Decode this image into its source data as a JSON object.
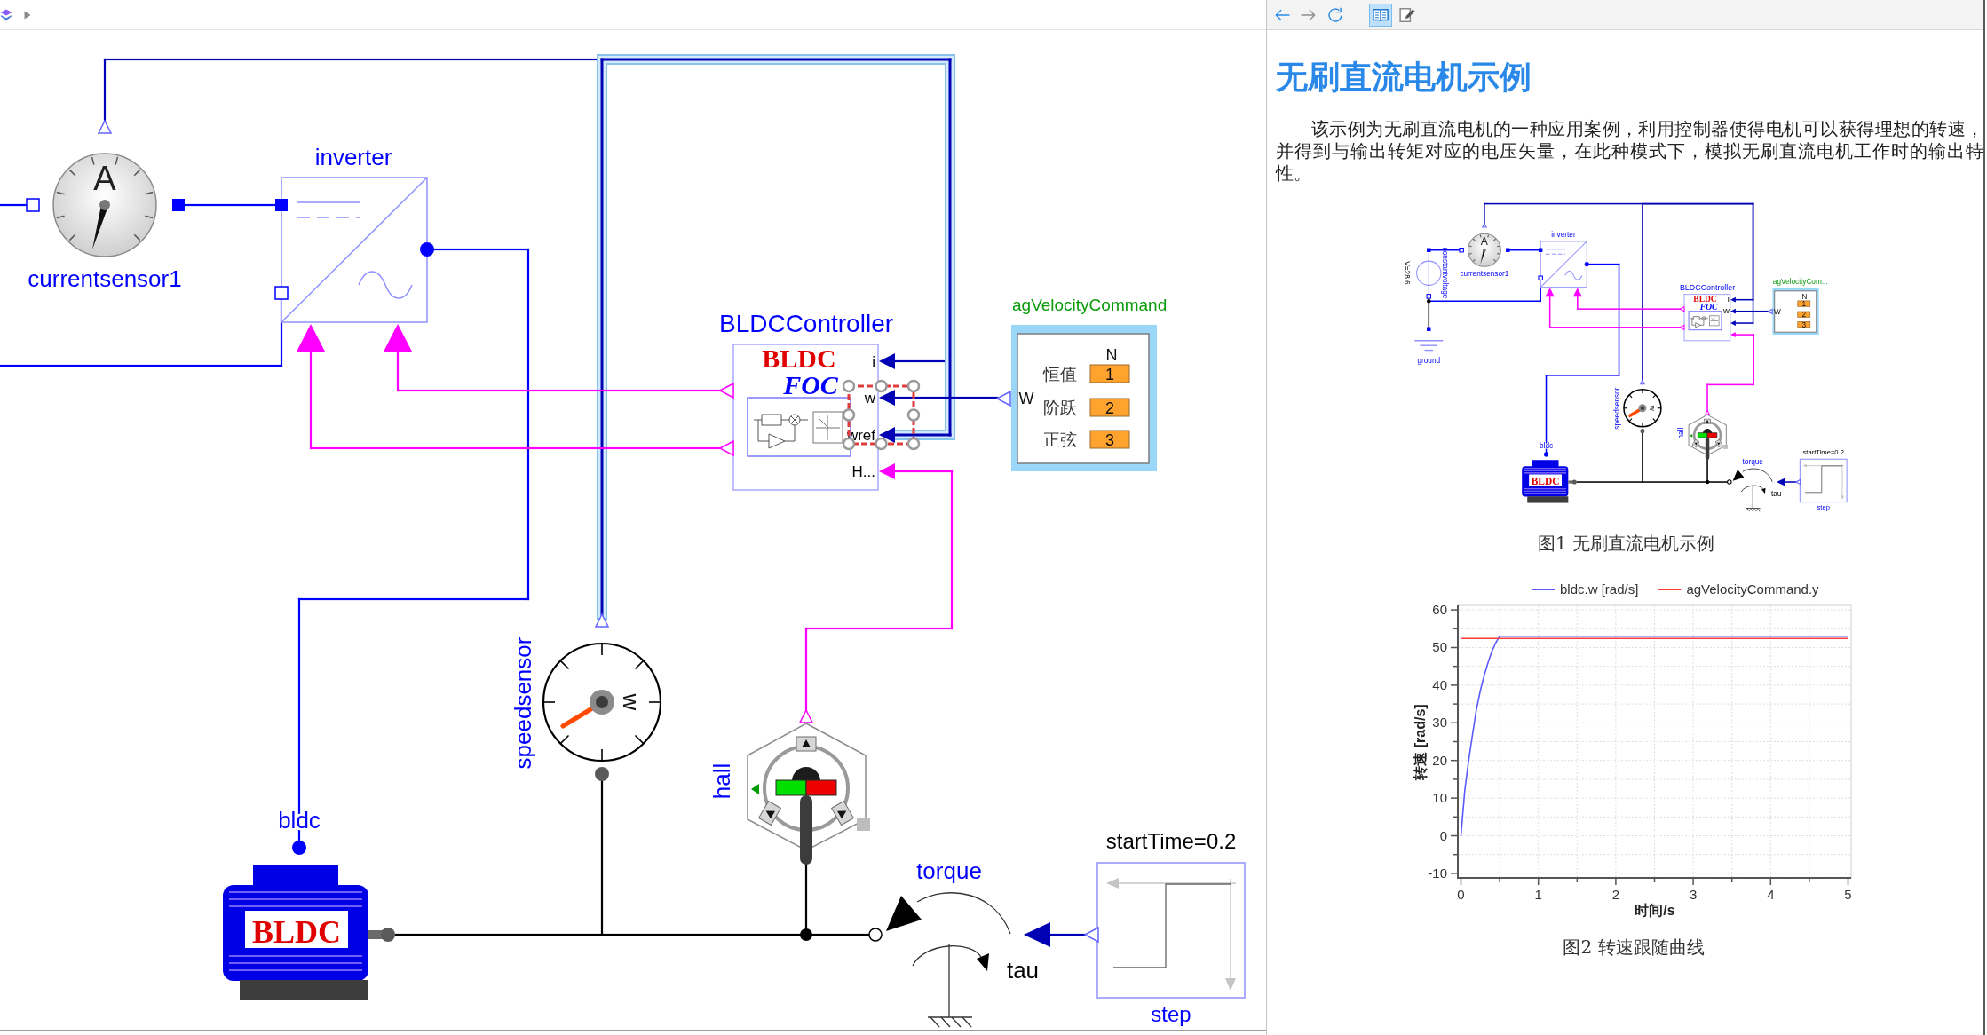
{
  "toolbar": {
    "nav_buttons": [
      {
        "disabled": false
      },
      {
        "disabled": true
      }
    ],
    "mode_buttons": [
      {
        "selected": true
      },
      {
        "selected": false
      }
    ]
  },
  "diagram": {
    "components": [
      {
        "kind": "current_sensor",
        "label": "currentsensor1",
        "symbol": "A"
      },
      {
        "kind": "inverter",
        "label": "inverter"
      },
      {
        "kind": "controller",
        "label": "BLDCController",
        "title": "BLDC",
        "subtitle": "FOC",
        "ports": [
          {
            "label": "i",
            "selected": false
          },
          {
            "label": "w",
            "selected": false
          },
          {
            "label": "wref",
            "selected": true
          },
          {
            "label": "H...",
            "selected": false
          }
        ]
      },
      {
        "kind": "command",
        "label": "agVelocityCommand",
        "port_label": "W",
        "column_header": "N",
        "rows": [
          {
            "label": "恒值",
            "value": "1"
          },
          {
            "label": "阶跃",
            "value": "2"
          },
          {
            "label": "正弦",
            "value": "3"
          }
        ]
      },
      {
        "kind": "speed_sensor",
        "label": "speedsensor",
        "symbol": "w"
      },
      {
        "kind": "hall_sensor",
        "label": "hall"
      },
      {
        "kind": "motor",
        "label": "bldc",
        "badge": "BLDC"
      },
      {
        "kind": "torque",
        "label": "torque",
        "input_label": "tau"
      },
      {
        "kind": "step",
        "parameter": "startTime=0.2",
        "label": "step"
      }
    ],
    "connections": [
      {
        "selected": false
      },
      {
        "selected": true
      },
      {
        "selected": false
      },
      {
        "selected": false
      },
      {
        "selected": false
      },
      {
        "selected": false
      },
      {
        "selected": false
      },
      {
        "selected": false
      },
      {
        "selected": false
      },
      {
        "selected": false
      },
      {
        "selected": false
      },
      {
        "selected": false
      },
      {
        "selected": false
      },
      {
        "selected": false
      }
    ]
  },
  "document": {
    "title": "无刷直流电机示例",
    "paragraph": "该示例为无刷直流电机的一种应用案例，利用控制器使得电机可以获得理想的转速，并得到与输出转矩对应的电压矢量，在此种模式下，模拟无刷直流电机工作时的输出特性。",
    "figure_1": {
      "components": [
        {
          "kind": "voltage_source",
          "label": "constantvoltage",
          "parameter": "V=28.6"
        },
        {
          "kind": "current_sensor",
          "label": "currentsensor1",
          "symbol": "A"
        },
        {
          "kind": "inverter",
          "label": "inverter"
        },
        {
          "kind": "ground",
          "label": "ground"
        },
        {
          "kind": "controller",
          "label": "BLDCController",
          "title": "BLDC",
          "subtitle": "FOC",
          "ports": [
            {
              "label": "i"
            },
            {
              "label": "w"
            }
          ]
        },
        {
          "kind": "command",
          "label": "agVelocityCom...",
          "port_label": "W",
          "column_header": "N",
          "rows": [
            {
              "value": "1"
            },
            {
              "value": "2"
            },
            {
              "value": "3"
            }
          ]
        },
        {
          "kind": "speed_sensor",
          "label": "speedsensor",
          "symbol": "w"
        },
        {
          "kind": "hall_sensor",
          "label": "hall"
        },
        {
          "kind": "motor",
          "label": "bldc",
          "badge": "BLDC"
        },
        {
          "kind": "torque",
          "label": "torque",
          "input_label": "tau"
        },
        {
          "kind": "step",
          "parameter": "startTime=0.2",
          "label": "step"
        }
      ],
      "caption": "图1 无刷直流电机示例"
    },
    "figure_2": {
      "chart_data": {
        "type": "line",
        "xlabel": "时间/s",
        "ylabel": "转速 [rad/s]",
        "x": [
          0,
          0.05,
          0.1,
          0.15,
          0.2,
          0.25,
          0.3,
          0.35,
          0.4,
          0.45,
          0.5,
          1,
          2,
          3,
          4,
          5
        ],
        "series": [
          {
            "name": "bldc.w [rad/s]",
            "color": "#5a5aff",
            "values": [
              0,
              12,
              20,
              27,
              33.5,
              38.5,
              42.5,
              46,
              49,
              51.3,
              53,
              53,
              53,
              53,
              53,
              53
            ]
          },
          {
            "name": "agVelocityCommand.y",
            "color": "#ff3c3c",
            "values": [
              52.4,
              52.4,
              52.4,
              52.4,
              52.4,
              52.4,
              52.4,
              52.4,
              52.4,
              52.4,
              52.4,
              52.4,
              52.4,
              52.4,
              52.4,
              52.4
            ]
          }
        ],
        "xlim": [
          -0.04,
          5.04
        ],
        "ylim": [
          -11.2,
          61.2
        ],
        "xticks": [
          {
            "value": 0,
            "label": "0"
          },
          {
            "value": 1,
            "label": "1"
          },
          {
            "value": 2,
            "label": "2"
          },
          {
            "value": 3,
            "label": "3"
          },
          {
            "value": 4,
            "label": "4"
          },
          {
            "value": 5,
            "label": "5"
          }
        ],
        "yticks": [
          -10,
          0,
          10,
          20,
          30,
          40,
          50,
          60
        ],
        "grid": true,
        "legend": "upper center"
      },
      "caption": "图2 转速跟随曲线"
    }
  }
}
